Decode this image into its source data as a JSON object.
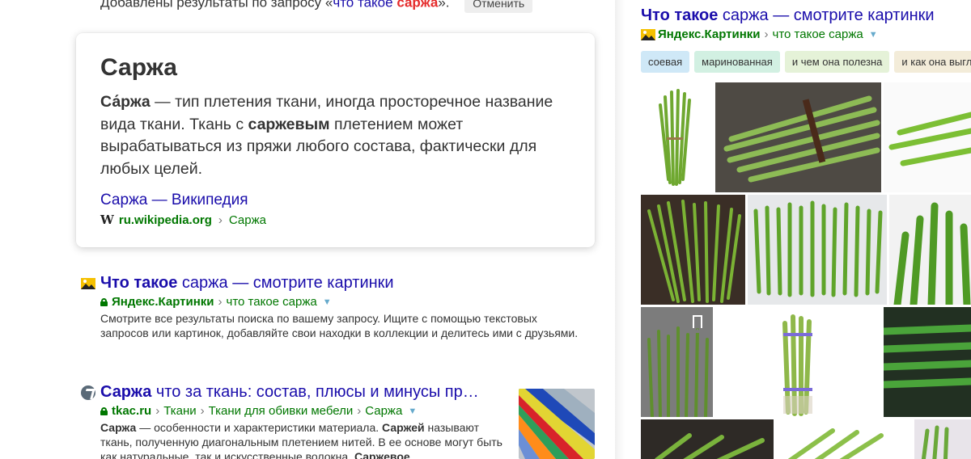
{
  "top": {
    "prefix": "Добавлены результаты по запросу «",
    "query_plain": "что такое ",
    "query_bold": "саржа",
    "suffix": "».",
    "cancel_label": "Отменить"
  },
  "fact": {
    "title": "Саржа",
    "text_bold1": "Са́ржа",
    "text1": " — тип плетения ткани, иногда просторечное название вида ткани. Ткань с ",
    "text_bold2": "саржевым",
    "text2": " плетением может вырабатываться из пряжи любого состава, фактически для любых целей.",
    "link": "Саржа — Википедия",
    "source_icon": "W",
    "source_domain": "ru.wikipedia.org",
    "source_sep": "›",
    "source_crumb": "Саржа"
  },
  "results": [
    {
      "icon": "image-gallery-icon",
      "title_bold": "Что такое",
      "title_rest": " саржа — смотрите картинки",
      "site": "Яндекс.Картинки",
      "sep": "›",
      "crumb": "что такое саржа",
      "snippet": "Смотрите все результаты поиска по вашему запросу. Ищите с помощью текстовых запросов или картинок, добавляйте свои находки в коллекции и делитесь ими с друзьями."
    },
    {
      "icon": "tkac-site-icon",
      "title_bold": "Саржа",
      "title_rest": " что за ткань: состав, плюсы и минусы пр…",
      "site": "tkac.ru",
      "sep": "›",
      "crumbs": [
        "Ткани",
        "Ткани для обивки мебели",
        "Саржа"
      ],
      "snippet_bold1": "Саржа",
      "snippet1": " — особенности и характеристики материала. ",
      "snippet_bold2": "Саржей",
      "snippet2": " называют ткань, полученную диагональным плетением нитей. В ее основе могут быть как натуральные, так и искусственные волокна. ",
      "snippet_bold3": "Саржевое"
    }
  ],
  "right": {
    "title_bold": "Что такое",
    "title_rest": " саржа — смотрите картинки",
    "site": "Яндекс.Картинки",
    "sep": "›",
    "crumb": "что такое саржа",
    "tags": [
      {
        "label": "соевая",
        "color": "#cfe8f7"
      },
      {
        "label": "маринованная",
        "color": "#d2f0e2"
      },
      {
        "label": "и чем она полезна",
        "color": "#e5f2d8"
      },
      {
        "label": "и как она выглядит",
        "color": "#f3ecd9"
      }
    ]
  },
  "colors": {
    "link": "#1a0dab",
    "green_url": "#007700",
    "asparagus": "#7fb33c"
  }
}
